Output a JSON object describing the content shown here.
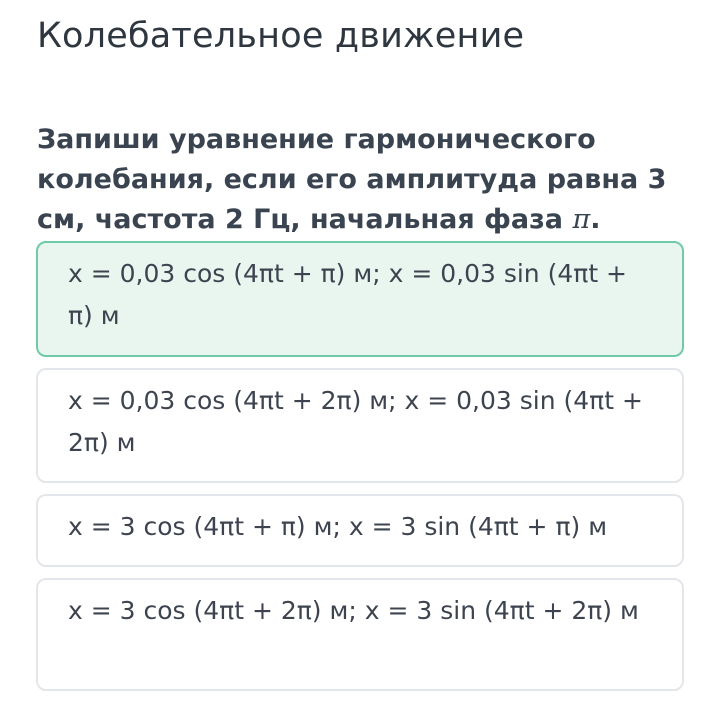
{
  "page": {
    "title": "Колебательное движение"
  },
  "question": {
    "text": "Запиши уравнение гармонического колебания, если его амплитуда равна 3 см, частота 2 Гц, начальная фаза ",
    "symbol": "π",
    "end": "."
  },
  "options": [
    {
      "text": "x = 0,03 cos (4πt + π) м; x = 0,03 sin (4πt + π) м",
      "selected": true
    },
    {
      "text": "x = 0,03 cos (4πt + 2π) м; x = 0,03 sin (4πt + 2π) м",
      "selected": false
    },
    {
      "text": "x = 3 cos (4πt + π) м; x = 3 sin (4πt + π) м",
      "selected": false
    },
    {
      "text": "x = 3 cos (4πt + 2π) м; x = 3 sin (4πt + 2π) м",
      "selected": false
    }
  ],
  "colors": {
    "selected_border": "#6fcba7",
    "selected_background": "#e9f6ef",
    "option_border": "#e3e6ea"
  }
}
